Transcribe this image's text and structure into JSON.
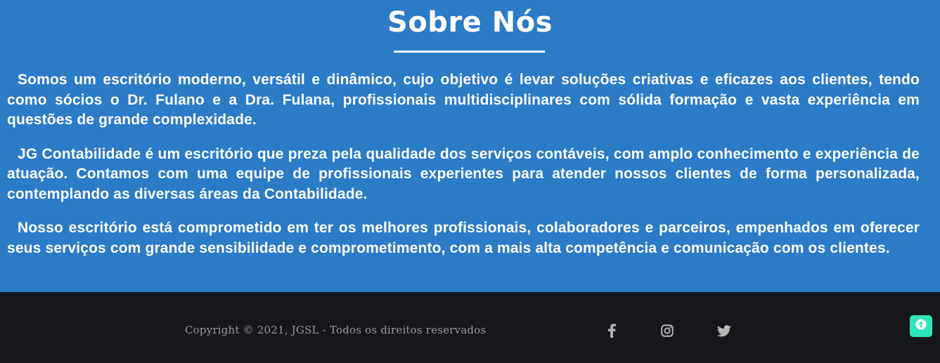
{
  "about": {
    "title": "Sobre Nós",
    "paragraphs": [
      "Somos um escritório moderno, versátil e dinâmico, cujo objetivo é levar soluções criativas e eficazes aos clientes, tendo como sócios o Dr. Fulano e a Dra. Fulana, profissionais multidisciplinares com sólida formação e vasta experiência em questões de grande complexidade.",
      "JG Contabilidade é um escritório que preza pela qualidade dos serviços contáveis, com amplo conhecimento e experiência de atuação. Contamos com uma equipe de profissionais experientes para atender nossos clientes de forma personalizada, contemplando as diversas áreas da Contabilidade.",
      "Nosso escritório está comprometido em ter os melhores profissionais, colaboradores e parceiros, empenhados em oferecer seus serviços com grande sensibilidade e comprometimento, com a mais alta competência e comunicação com os clientes."
    ]
  },
  "footer": {
    "copyright": "Copyright © 2021, JGSL - Todos os direitos reservados",
    "social_icons": [
      "facebook-icon",
      "instagram-icon",
      "twitter-icon"
    ]
  },
  "back_to_top": {
    "icon": "arrow-up-icon"
  },
  "colors": {
    "about_background": "#2b7bc6",
    "footer_background": "#16171b",
    "text_light": "#ffffff",
    "footer_text": "#9a9a9a",
    "social_icon": "#b5b5b5",
    "accent": "#2ee5b8"
  }
}
